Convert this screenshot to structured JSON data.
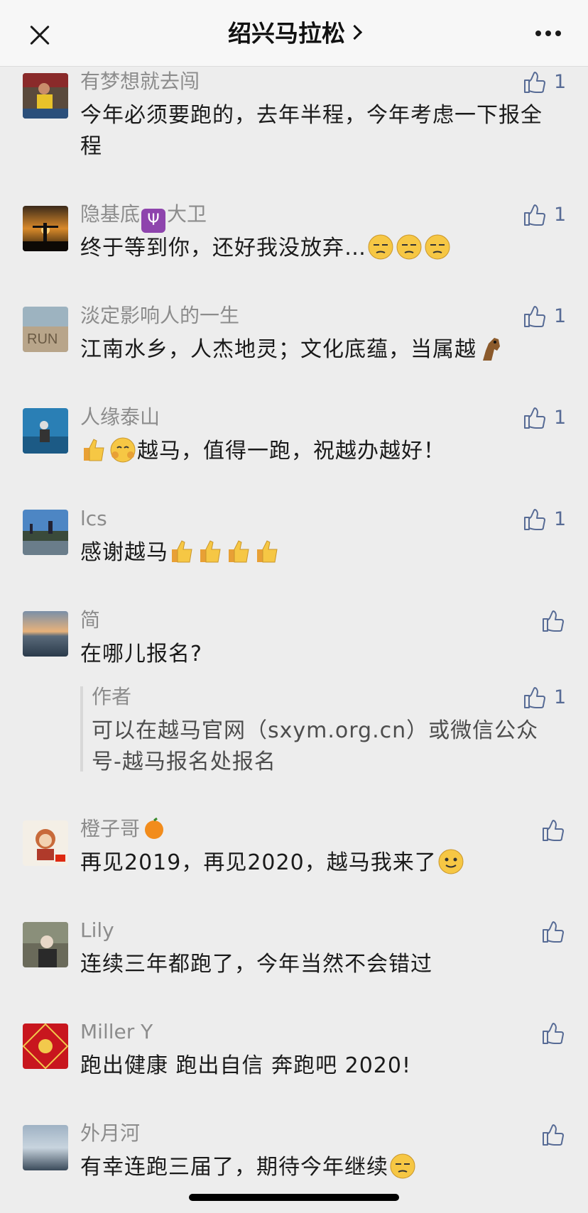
{
  "header": {
    "title": "绍兴马拉松"
  },
  "comments": [
    {
      "name": "有梦想就去闯",
      "text": "今年必须要跑的，去年半程，今年考虑一下报全程",
      "likes": "1"
    },
    {
      "name_a": "隐基底",
      "name_b": "大卫",
      "text": "终于等到你，还好我没放弃…",
      "likes": "1"
    },
    {
      "name": "淡定影响人的一生",
      "text": "江南水乡，人杰地灵；文化底蕴，当属越",
      "likes": "1"
    },
    {
      "name": "人缘泰山",
      "text": "越马，值得一跑，祝越办越好！",
      "likes": "1"
    },
    {
      "name": "lcs",
      "text": "感谢越马",
      "likes": "1"
    },
    {
      "name": "简",
      "text": "在哪儿报名?",
      "reply": {
        "author": "作者",
        "text": "可以在越马官网（sxym.org.cn）或微信公众号-越马报名处报名",
        "likes": "1"
      }
    },
    {
      "name": "橙子哥",
      "text": "再见2019，再见2020，越马我来了"
    },
    {
      "name": "Lily",
      "text": "连续三年都跑了，今年当然不会错过"
    },
    {
      "name": "Miller Y",
      "text": "跑出健康 跑出自信 奔跑吧 2020!"
    },
    {
      "name": "外月河",
      "text": "有幸连跑三届了，期待今年继续"
    }
  ],
  "colors": {
    "link_blue": "#576b95",
    "background": "#ededed",
    "name_gray": "#8c8c8c"
  }
}
